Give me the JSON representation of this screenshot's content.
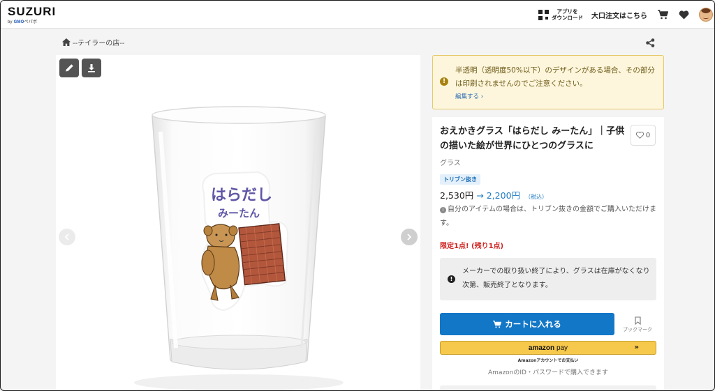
{
  "header": {
    "logo": "SUZURI",
    "logo_sub_prefix": "by ",
    "logo_sub_brand": "GMO",
    "logo_sub_suffix": "ペパボ",
    "app_download_line1": "アプリを",
    "app_download_line2": "ダウンロード",
    "bulk_order": "大口注文はこちら",
    "icons": [
      "qr-icon",
      "cart-icon",
      "heart-icon",
      "avatar"
    ]
  },
  "breadcrumb": {
    "shop_name": "--テイラーの店--"
  },
  "image_panel": {
    "glass_text_line1": "はらだし",
    "glass_text_line2": "みーたん"
  },
  "notice": {
    "text": "半透明（透明度50%以下）のデザインがある場合、その部分は印刷されませんのでご注意ください。",
    "edit_link": "編集する"
  },
  "product": {
    "title": "おえかきグラス「はらだし みーたん」｜子供の描いた絵が世界にひとつのグラスに",
    "favorite_count": "0",
    "category": "グラス",
    "badge": "トリブン抜き",
    "price_old": "2,530円",
    "price_arrow": "→",
    "price_new": "2,200円",
    "tax_label": "（税込）",
    "owner_note": "自分のアイテムの場合は、トリブン抜きの金額でご購入いただけます。",
    "limited": "限定1点! (残り1点)",
    "discontinued_notice": "メーカーでの取り扱い終了により、グラスは在庫がなくなり次第、販売終了となります。",
    "cart_button": "カートに入れる",
    "bookmark_label": "ブックマーク",
    "amazon_pay_brand": "amazon",
    "amazon_pay_word": "pay",
    "amazon_pay_chevron": "»",
    "amazon_pay_sub": "Amazonアカウントでお支払い",
    "amazon_id_note": "AmazonのID・パスワードで購入できます"
  },
  "colors": {
    "accent_blue": "#1377c7",
    "notice_bg": "#fdf6dc",
    "limited_red": "#d0231f",
    "amazon_yellow": "#f6c84b"
  }
}
